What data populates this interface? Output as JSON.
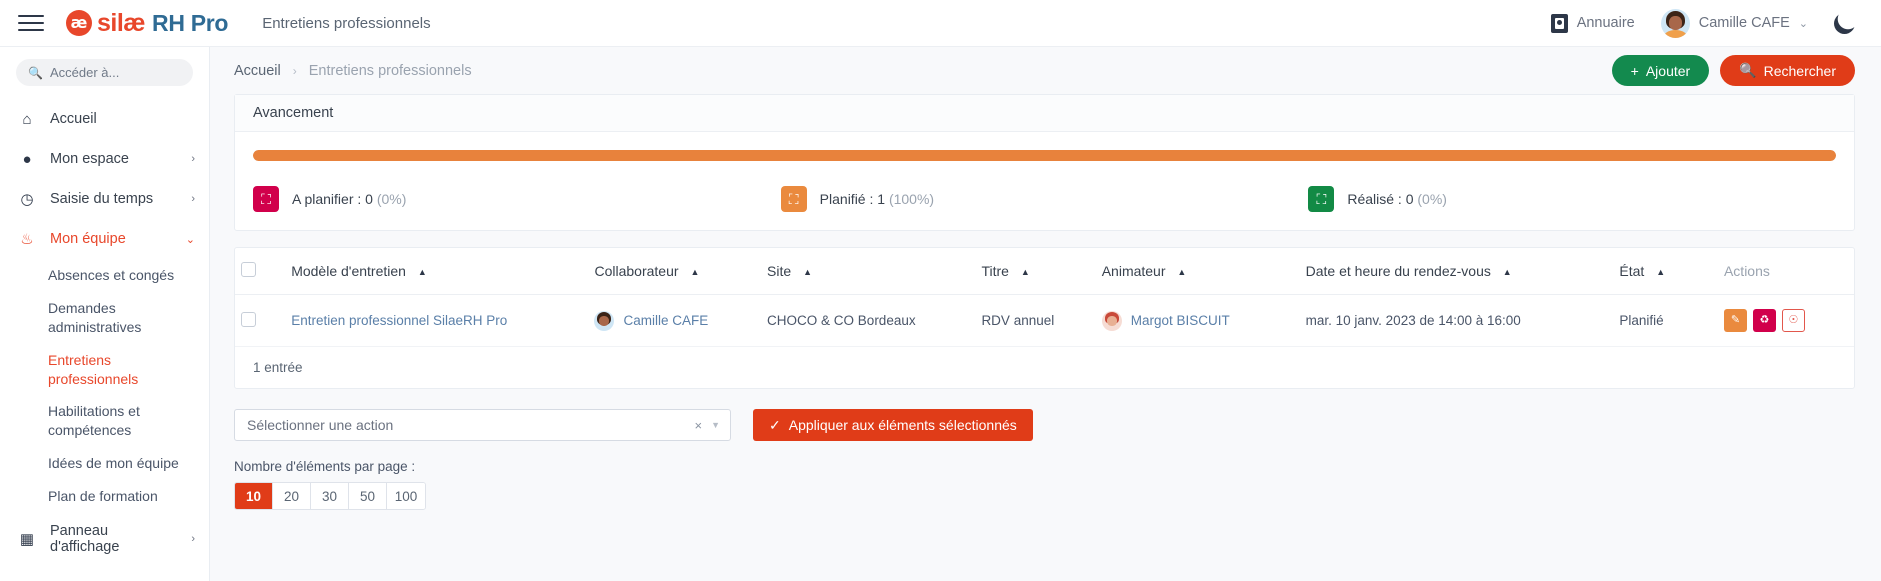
{
  "topbar": {
    "menu_icon": "hamburger-icon",
    "logo_mark": "æ",
    "logo_silae": "silæ",
    "logo_rh": "RH Pro",
    "page_title": "Entretiens professionnels",
    "annuaire_label": "Annuaire",
    "user_name": "Camille CAFE",
    "chevron": "⌄",
    "theme_icon": "moon-icon"
  },
  "sidebar": {
    "search_placeholder": "Accéder à...",
    "items": [
      {
        "label": "Accueil",
        "icon": "home-icon",
        "glyph": "⌂",
        "chevron": "",
        "active": false
      },
      {
        "label": "Mon espace",
        "icon": "user-icon",
        "glyph": "👤",
        "chevron": "›",
        "active": false
      },
      {
        "label": "Saisie du temps",
        "icon": "clock-icon",
        "glyph": "◷",
        "chevron": "›",
        "active": false
      },
      {
        "label": "Mon équipe",
        "icon": "team-icon",
        "glyph": "👥",
        "chevron": "⌄",
        "active": true
      }
    ],
    "sub_items": [
      {
        "label": "Absences et congés",
        "active": false
      },
      {
        "label": "Demandes administratives",
        "active": false
      },
      {
        "label": "Entretiens professionnels",
        "active": true
      },
      {
        "label": "Habilitations et compétences",
        "active": false
      },
      {
        "label": "Idées de mon équipe",
        "active": false
      },
      {
        "label": "Plan de formation",
        "active": false
      }
    ],
    "footer_item": {
      "label": "Panneau d'affichage",
      "icon": "board-icon",
      "glyph": "🖵",
      "chevron": "›"
    }
  },
  "breadcrumb": {
    "home": "Accueil",
    "separator": "›",
    "current": "Entretiens professionnels"
  },
  "actions": {
    "add_label": "Ajouter",
    "add_icon": "plus-icon",
    "add_glyph": "+",
    "search_label": "Rechercher",
    "search_icon": "magnifier-icon",
    "search_glyph": "🔍"
  },
  "progress_card": {
    "title": "Avancement",
    "bar_percent": 100,
    "bar_color": "#e8823c",
    "stats": [
      {
        "icon": "calendar-plus-icon",
        "glyph": "▣",
        "color": "#d1004b",
        "label": "A planifier : 0",
        "percent": "(0%)"
      },
      {
        "icon": "calendar-icon",
        "glyph": "▦",
        "color": "#ea8a3e",
        "label": "Planifié : 1",
        "percent": "(100%)"
      },
      {
        "icon": "calendar-check-icon",
        "glyph": "☑",
        "color": "#128a45",
        "label": "Réalisé : 0",
        "percent": "(0%)"
      }
    ]
  },
  "table": {
    "columns": [
      {
        "label": "",
        "sortable": false
      },
      {
        "label": "Modèle d'entretien",
        "sortable": true
      },
      {
        "label": "Collaborateur",
        "sortable": true
      },
      {
        "label": "Site",
        "sortable": true
      },
      {
        "label": "Titre",
        "sortable": true
      },
      {
        "label": "Animateur",
        "sortable": true
      },
      {
        "label": "Date et heure du rendez-vous",
        "sortable": true
      },
      {
        "label": "État",
        "sortable": true
      },
      {
        "label": "Actions",
        "sortable": false
      }
    ],
    "sort_glyph": "▲",
    "rows": [
      {
        "modele": "Entretien professionnel SilaeRH Pro",
        "collaborateur": "Camille CAFE",
        "site": "CHOCO & CO Bordeaux",
        "titre": "RDV annuel",
        "animateur": "Margot BISCUIT",
        "date": "mar. 10 janv. 2023 de 14:00 à 16:00",
        "etat": "Planifié",
        "actions": [
          {
            "name": "edit-button",
            "glyph": "✎"
          },
          {
            "name": "delete-button",
            "glyph": "🗑"
          },
          {
            "name": "history-button",
            "glyph": "◷"
          }
        ]
      }
    ],
    "entries_text": "1 entrée"
  },
  "bulk": {
    "select_placeholder": "Sélectionner une action",
    "clear_glyph": "×",
    "caret_glyph": "▼",
    "apply_label": "Appliquer aux éléments sélectionnés",
    "apply_icon": "check-circle-icon",
    "apply_glyph": "✔"
  },
  "pagination": {
    "label": "Nombre d'éléments par page :",
    "options": [
      "10",
      "20",
      "30",
      "50",
      "100"
    ],
    "selected": "10"
  }
}
